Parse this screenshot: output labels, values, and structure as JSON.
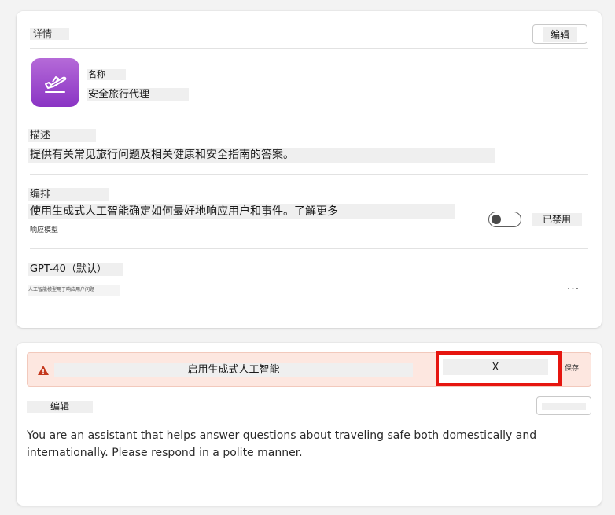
{
  "details": {
    "title": "详情",
    "edit_label": "编辑",
    "name_label": "名称",
    "name_value": "安全旅行代理",
    "description_label": "描述",
    "description_value": "提供有关常见旅行问题及相关健康和安全指南的答案。",
    "orchestration_label": "编排",
    "orchestration_value": "使用生成式人工智能确定如何最好地响应用户和事件。了解更多",
    "orchestration_sub": "响应模型",
    "toggle_label": "已禁用",
    "toggle_state": "off",
    "model_value": "GPT-40（默认）",
    "model_sub": "人工智能模型用于响应用户问题",
    "more_label": "..."
  },
  "instructions": {
    "warning_text": "启用生成式人工智能",
    "dismiss_label": "X",
    "save_label": "保存",
    "edit_label": "编辑",
    "edit_button_label": "",
    "body_text": "You are an assistant that helps answer questions about traveling safe both domestically and internationally. Please respond in a polite manner."
  },
  "colors": {
    "accent_icon": "#9b4bcd",
    "warning_bg": "#fde7e0",
    "warning_icon": "#c4371c",
    "highlight_border": "#e6150f"
  },
  "icons": {
    "app_icon": "airplane-takeoff-icon",
    "warning_icon": "warning-triangle-icon",
    "more_icon": "ellipsis-icon"
  }
}
